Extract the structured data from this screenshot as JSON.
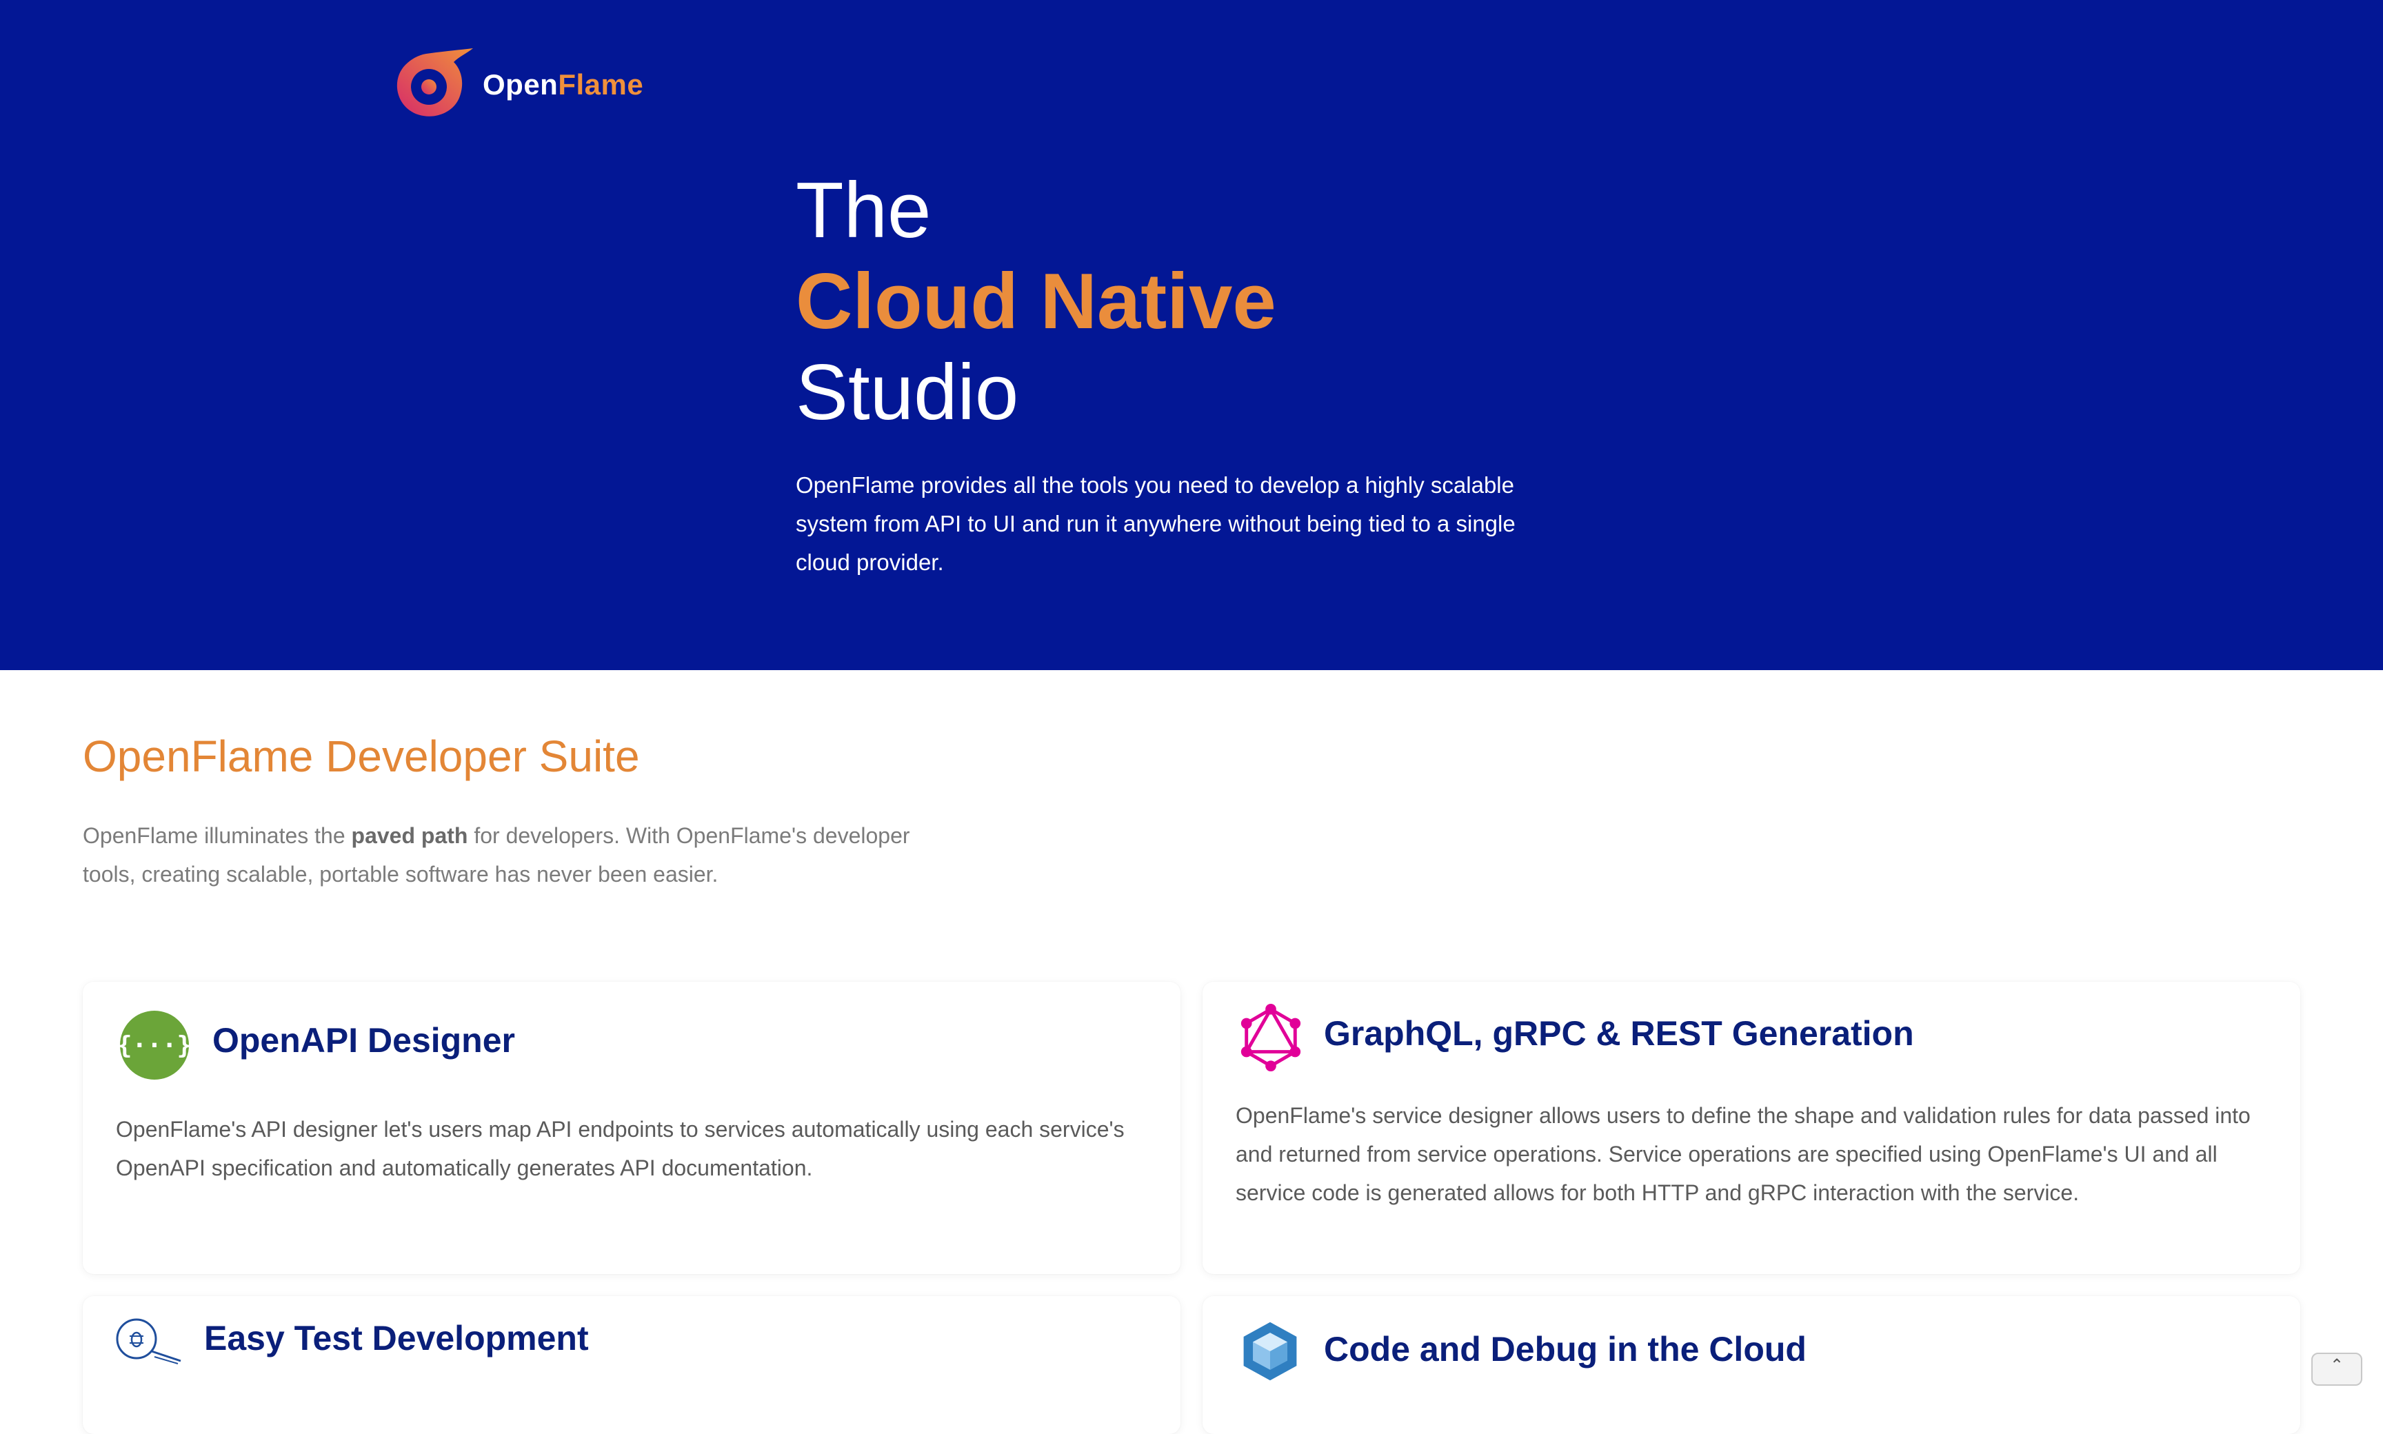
{
  "colors": {
    "hero_background": "#031795",
    "accent_orange": "#ea8d3c",
    "heading_navy": "#0a1f7a",
    "openapi_green": "#6ba539",
    "graphql_pink": "#e10098",
    "cloud_blue": "#2f7fc1"
  },
  "header": {
    "logo_icon": "openflame-logo-icon",
    "logo_text_primary": "Open",
    "logo_text_accent": "Flame"
  },
  "hero": {
    "title_line1": "The",
    "title_line2": "Cloud Native",
    "title_line3": "Studio",
    "description": "OpenFlame provides all the tools you need to develop a highly scalable system from API to UI and run it anywhere without being tied to a single cloud provider."
  },
  "suite": {
    "title": "OpenFlame Developer Suite",
    "desc_before": "OpenFlame illuminates the ",
    "desc_bold": "paved path",
    "desc_after": " for developers. With OpenFlame's developer tools, creating scalable, portable software has never been easier."
  },
  "cards": [
    {
      "icon": "openapi-icon",
      "title": "OpenAPI Designer",
      "description": "OpenFlame's API designer let's users map API endpoints to services automatically using each service's OpenAPI specification and automatically generates API documentation."
    },
    {
      "icon": "graphql-icon",
      "title": "GraphQL, gRPC & REST Generation",
      "description": "OpenFlame's service designer allows users to define the shape and validation rules for data passed into and returned from service operations.  Service operations are specified using OpenFlame's UI and all service code is generated allows for both HTTP and gRPC interaction with the service."
    },
    {
      "icon": "bug-search-icon",
      "title": "Easy Test Development",
      "description": ""
    },
    {
      "icon": "cube-icon",
      "title": "Code and Debug in the Cloud",
      "description": ""
    }
  ],
  "scroll_top_icon": "chevron-up-icon",
  "scroll_top_glyph": "⌃"
}
